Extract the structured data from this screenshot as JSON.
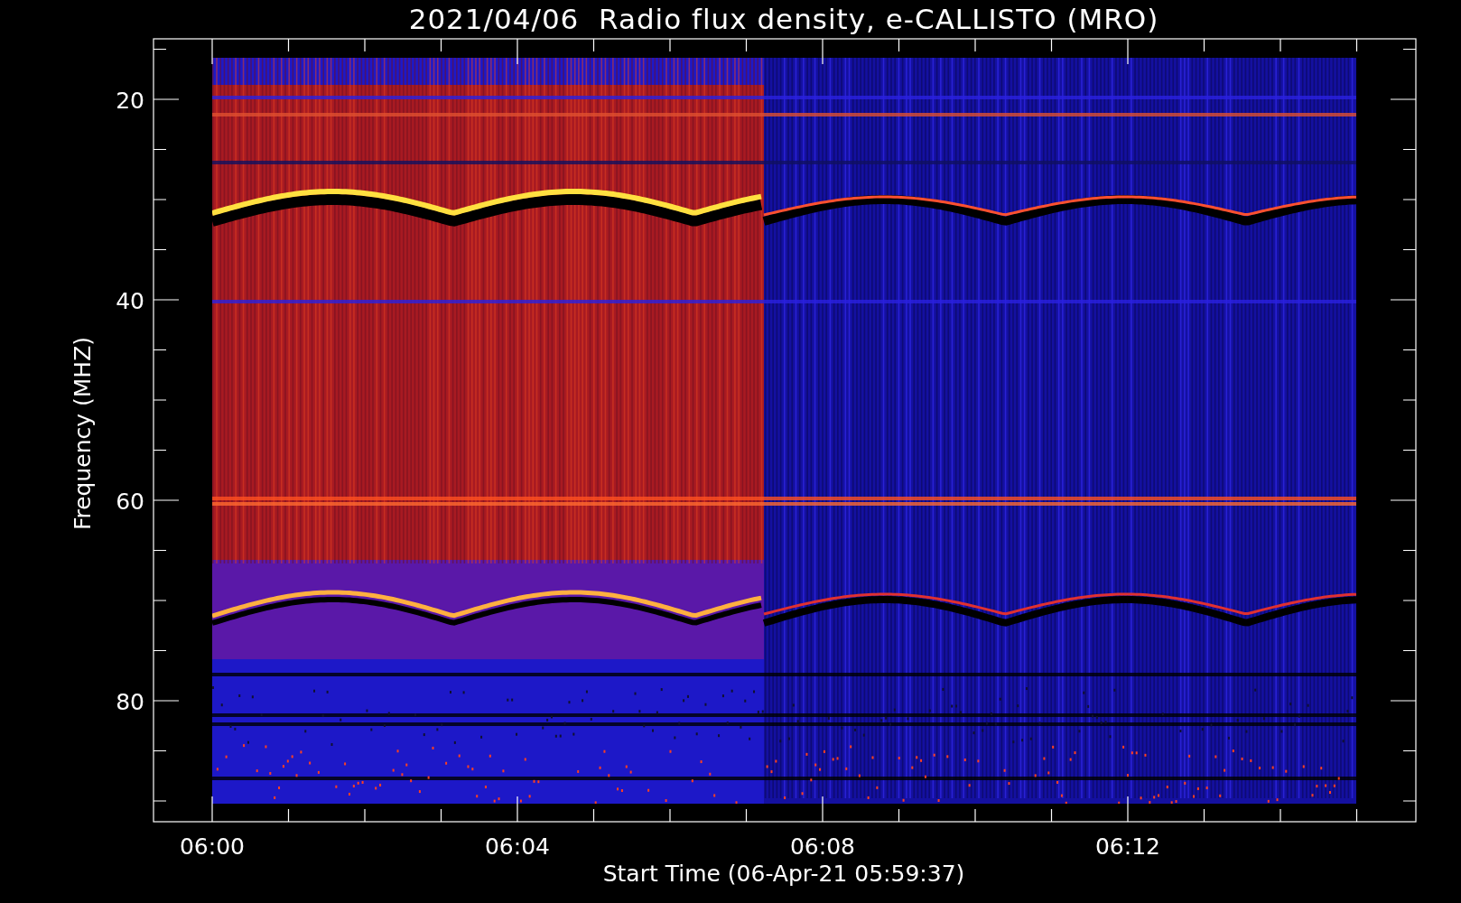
{
  "plot": {
    "title": "2021/04/06  Radio flux density, e-CALLISTO (MRO)",
    "ylabel": "Frequency (MHZ)",
    "xlabel": "Start Time (06-Apr-21 05:59:37)",
    "y_tick_labels": [
      "20",
      "40",
      "60",
      "80"
    ],
    "x_tick_labels": [
      "06:00",
      "06:04",
      "06:08",
      "06:12"
    ]
  }
}
